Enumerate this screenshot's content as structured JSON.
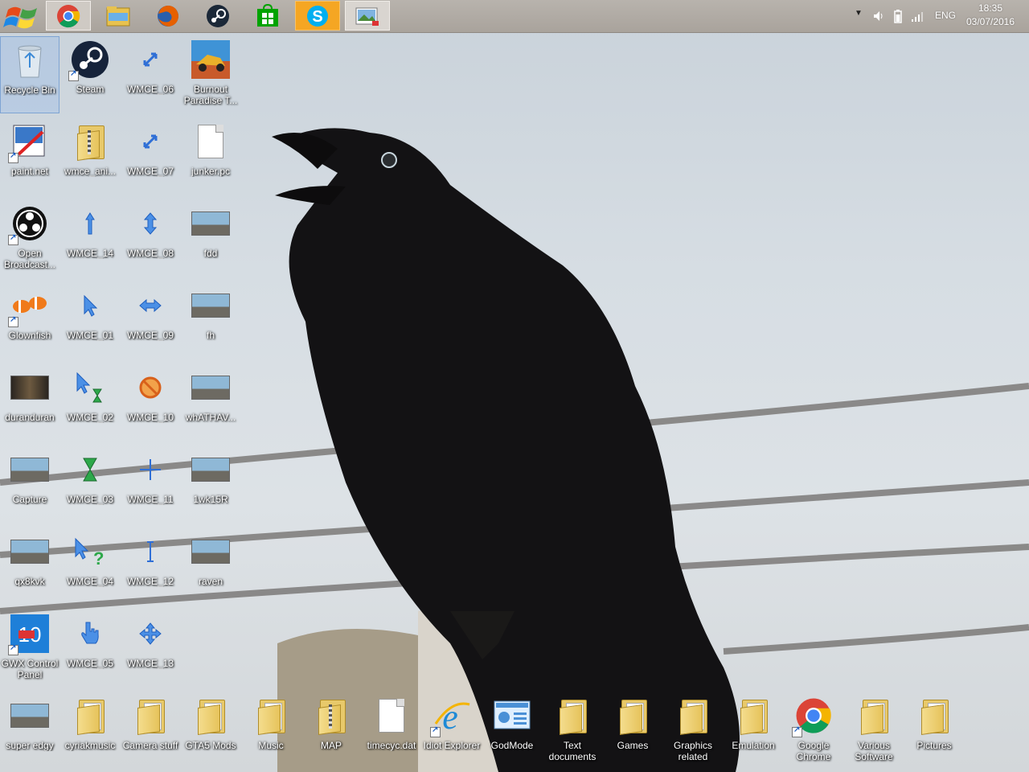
{
  "taskbar": {
    "pinned": [
      {
        "name": "start",
        "icon": "windows-flag-icon"
      },
      {
        "name": "chrome",
        "icon": "chrome-icon"
      },
      {
        "name": "file-explorer",
        "icon": "file-explorer-icon"
      },
      {
        "name": "firefox",
        "icon": "firefox-icon"
      },
      {
        "name": "steam",
        "icon": "steam-icon"
      },
      {
        "name": "store",
        "icon": "store-icon"
      },
      {
        "name": "skype",
        "icon": "skype-icon"
      },
      {
        "name": "photos",
        "icon": "photos-icon"
      }
    ],
    "tray": {
      "language": "ENG",
      "time": "18:35",
      "date": "03/07/2016"
    }
  },
  "desktop": {
    "icons": [
      {
        "label": "Recycle Bin",
        "icon": "recycle-bin-icon",
        "selected": true
      },
      {
        "label": "Steam",
        "icon": "steam-icon"
      },
      {
        "label": "WMCE_06",
        "icon": "diagonal-resize-cursor-icon"
      },
      {
        "label": "Burnout Paradise T...",
        "icon": "burnout-game-icon"
      },
      {
        "label": "paint.net",
        "icon": "paintnet-icon"
      },
      {
        "label": "wmce_ani...",
        "icon": "zip-folder-icon"
      },
      {
        "label": "WMCE_07",
        "icon": "diagonal-resize-cursor-icon"
      },
      {
        "label": "junker.pc",
        "icon": "file-icon"
      },
      {
        "label": "Open Broadcast...",
        "icon": "obs-icon"
      },
      {
        "label": "WMCE_14",
        "icon": "up-arrow-cursor-icon"
      },
      {
        "label": "WMCE_08",
        "icon": "vertical-resize-cursor-icon"
      },
      {
        "label": "fdd",
        "icon": "image-thumbnail-icon"
      },
      {
        "label": "Glownfish",
        "icon": "clownfish-icon"
      },
      {
        "label": "WMCE_01",
        "icon": "arrow-cursor-icon"
      },
      {
        "label": "WMCE_09",
        "icon": "horizontal-resize-cursor-icon"
      },
      {
        "label": "fh",
        "icon": "image-thumbnail-icon"
      },
      {
        "label": "duranduran",
        "icon": "video-thumbnail-icon"
      },
      {
        "label": "WMCE_02",
        "icon": "busy-cursor-icon"
      },
      {
        "label": "WMCE_10",
        "icon": "unavailable-cursor-icon"
      },
      {
        "label": "whATHAV...",
        "icon": "image-thumbnail-icon"
      },
      {
        "label": "Capture",
        "icon": "image-thumbnail-icon"
      },
      {
        "label": "WMCE_03",
        "icon": "hourglass-cursor-icon"
      },
      {
        "label": "WMCE_11",
        "icon": "crosshair-cursor-icon"
      },
      {
        "label": "1wk15R",
        "icon": "image-thumbnail-icon"
      },
      {
        "label": "qx8kvk",
        "icon": "image-thumbnail-icon"
      },
      {
        "label": "WMCE_04",
        "icon": "help-cursor-icon"
      },
      {
        "label": "WMCE_12",
        "icon": "text-cursor-icon"
      },
      {
        "label": "raven",
        "icon": "image-thumbnail-icon"
      },
      {
        "label": "GWX Control Panel",
        "icon": "gwx-icon"
      },
      {
        "label": "WMCE_05",
        "icon": "hand-cursor-icon"
      },
      {
        "label": "WMCE_13",
        "icon": "move-cursor-icon"
      }
    ],
    "bottom_row": [
      {
        "label": "super edgy",
        "icon": "image-thumbnail-icon"
      },
      {
        "label": "cyriakmusic",
        "icon": "folder-icon"
      },
      {
        "label": "Camera stuff",
        "icon": "folder-icon"
      },
      {
        "label": "GTA5 Mods",
        "icon": "folder-icon"
      },
      {
        "label": "Music",
        "icon": "folder-icon"
      },
      {
        "label": "MAP",
        "icon": "zip-folder-icon"
      },
      {
        "label": "timecyc.dat",
        "icon": "file-icon"
      },
      {
        "label": "Idiot Explorer",
        "icon": "internet-explorer-icon"
      },
      {
        "label": "GodMode",
        "icon": "control-panel-icon"
      },
      {
        "label": "Text documents",
        "icon": "folder-icon"
      },
      {
        "label": "Games",
        "icon": "folder-icon"
      },
      {
        "label": "Graphics related",
        "icon": "folder-icon"
      },
      {
        "label": "Emulation",
        "icon": "folder-icon"
      },
      {
        "label": "Google Chrome",
        "icon": "chrome-icon"
      },
      {
        "label": "Various Software",
        "icon": "folder-icon"
      },
      {
        "label": "Pictures",
        "icon": "folder-icon"
      }
    ]
  },
  "colors": {
    "taskbar": "#aaa49d",
    "skype_highlight": "#f5a623",
    "label_text": "#ffffff"
  }
}
